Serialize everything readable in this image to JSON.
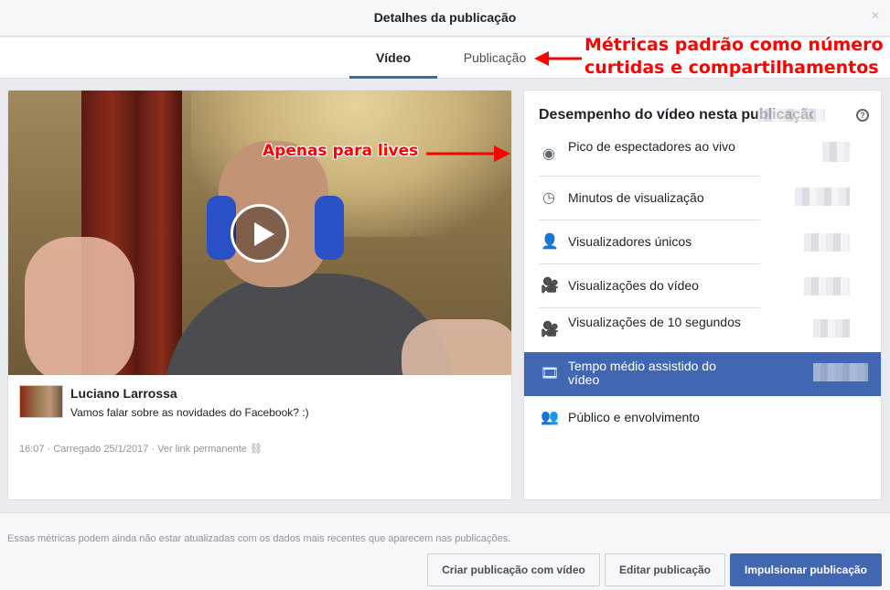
{
  "header": {
    "title": "Detalhes da publicação",
    "close_icon": "×"
  },
  "tabs": [
    {
      "label": "Vídeo",
      "active": true
    },
    {
      "label": "Publicação",
      "active": false
    }
  ],
  "annotations": {
    "top_line1": "Métricas padrão como número de",
    "top_line2": "curtidas e compartilhamentos",
    "lives": "Apenas para lives",
    "color": "#ff0000"
  },
  "post": {
    "author": "Luciano Larrossa",
    "text": "Vamos falar sobre as novidades do Facebook? :)",
    "time": "16:07",
    "uploaded": "Carregado 25/1/2017",
    "permalink": "Ver link permanente"
  },
  "performance": {
    "title": "Desempenho do vídeo nesta publicação",
    "help_icon": "?",
    "metrics": [
      {
        "icon": "eye-icon",
        "glyph": "◉",
        "label": "Pico de espectadores ao vivo"
      },
      {
        "icon": "clock-icon",
        "glyph": "◷",
        "label": "Minutos de visualização"
      },
      {
        "icon": "person-icon",
        "glyph": "👤",
        "label": "Visualizadores únicos"
      },
      {
        "icon": "video-camera-icon",
        "glyph": "🎥",
        "label": "Visualizações do vídeo"
      },
      {
        "icon": "video-camera-icon",
        "glyph": "🎥",
        "label": "Visualizações de 10 segundos"
      },
      {
        "icon": "film-icon",
        "glyph": "🎞",
        "label": "Tempo médio assistido do vídeo",
        "active": true
      },
      {
        "icon": "people-icon",
        "glyph": "👥",
        "label": "Público e envolvimento"
      }
    ]
  },
  "footer": {
    "note": "Essas métricas podem ainda não estar atualizadas com os dados mais recentes que aparecem nas publicações.",
    "create_label": "Criar publicação com vídeo",
    "edit_label": "Editar publicação",
    "boost_label": "Impulsionar publicação"
  },
  "colors": {
    "accent": "#4267b2",
    "annotation": "#ff0000"
  }
}
